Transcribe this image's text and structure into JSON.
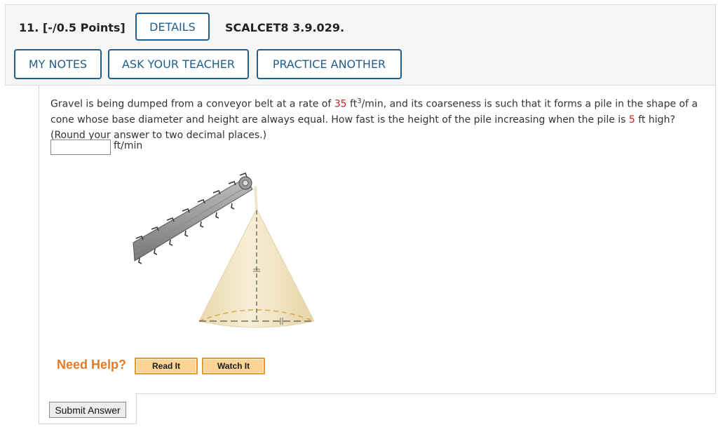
{
  "header": {
    "question_number": "11. [-/0.5 Points]",
    "details_label": "DETAILS",
    "code": "SCALCET8 3.9.029.",
    "my_notes_label": "MY NOTES",
    "ask_teacher_label": "ASK YOUR TEACHER",
    "practice_label": "PRACTICE ANOTHER"
  },
  "question": {
    "part1": "Gravel is being dumped from a conveyor belt at a rate of ",
    "rate": "35",
    "part2": " ft",
    "exp": "3",
    "part3": "/min, and its coarseness is such that it forms a pile in the shape of a cone whose base diameter and height are always equal. How fast is the height of the pile increasing when the pile is ",
    "height": "5",
    "part4": " ft high?",
    "round_note": "(Round your answer to two decimal places.)",
    "answer_value": "",
    "unit": "ft/min"
  },
  "help": {
    "label": "Need Help?",
    "read_it": "Read It",
    "watch_it": "Watch It"
  },
  "submit_label": "Submit Answer",
  "colors": {
    "accent": "#1f5f8b",
    "highlight": "#c8221c",
    "help": "#e07b29"
  }
}
